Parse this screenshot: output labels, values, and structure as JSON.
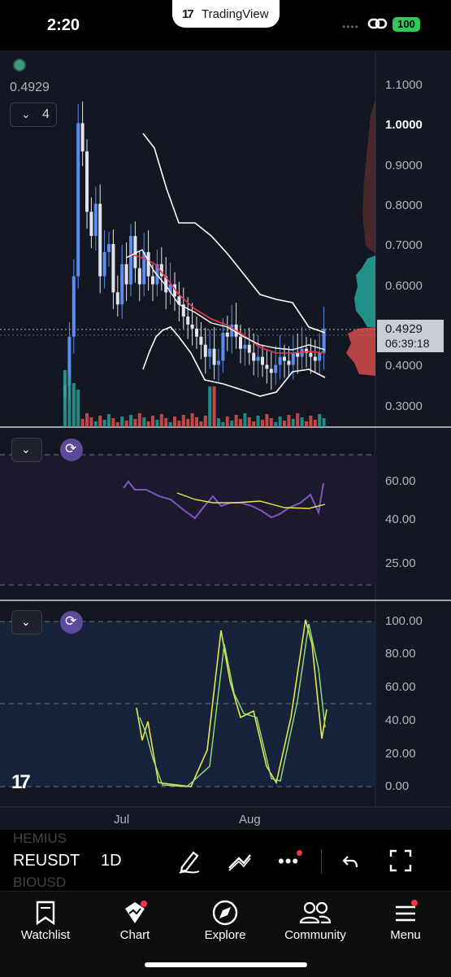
{
  "status_bar": {
    "time": "2:20",
    "app_pill": "TradingView",
    "battery": "100"
  },
  "chart": {
    "last_price": "0.4929",
    "indicator_count": "4",
    "price_badge": {
      "price": "0.4929",
      "countdown": "06:39:18"
    },
    "price_axis": [
      "1.1000",
      "1.0000",
      "0.9000",
      "0.8000",
      "0.7000",
      "0.6000",
      "0.4000",
      "0.3000"
    ],
    "rsi_axis": [
      "60.00",
      "40.00",
      "25.00"
    ],
    "stoch_axis": [
      "100.00",
      "80.00",
      "60.00",
      "40.00",
      "20.00",
      "0.00"
    ],
    "time_axis": [
      "Jul",
      "Aug"
    ],
    "watermark": "17",
    "colors": {
      "up": "#5b8def",
      "down": "#e0e3eb",
      "ma_red": "#f23645",
      "bands": "#ffffff",
      "rsi": "#7e57c2",
      "stoch_k": "#e6e84a",
      "stoch_d": "#9be07a",
      "volume_up": "#26a69a",
      "volume_down": "#ef5350"
    }
  },
  "toolbar": {
    "ghost_symbols": [
      "HEMIUS",
      "BIOUSD"
    ],
    "symbol": "REUSDT",
    "interval": "1D",
    "icons": [
      "pen-icon",
      "trend-line-icon",
      "more-dots-icon",
      "undo-icon",
      "fullscreen-icon"
    ]
  },
  "tabs": [
    {
      "label": "Watchlist",
      "icon": "bookmark-icon"
    },
    {
      "label": "Chart",
      "icon": "chart-icon"
    },
    {
      "label": "Explore",
      "icon": "compass-icon"
    },
    {
      "label": "Community",
      "icon": "people-icon"
    },
    {
      "label": "Menu",
      "icon": "menu-icon"
    }
  ]
}
